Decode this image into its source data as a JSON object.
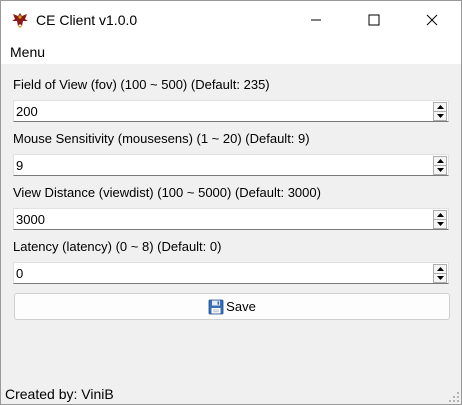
{
  "window": {
    "title": "CE Client v1.0.0",
    "controls": [
      "minimize",
      "maximize",
      "close"
    ]
  },
  "menubar": {
    "items": [
      {
        "label": "Menu"
      }
    ]
  },
  "fields": [
    {
      "label": "Field of View (fov) (100 ~ 500) (Default: 235)",
      "value": "200"
    },
    {
      "label": "Mouse Sensitivity (mousesens) (1 ~ 20) (Default: 9)",
      "value": "9"
    },
    {
      "label": "View Distance (viewdist) (100 ~ 5000) (Default: 3000)",
      "value": "3000"
    },
    {
      "label": "Latency (latency) (0 ~ 8) (Default: 0)",
      "value": "0"
    }
  ],
  "save_button": {
    "label": "Save",
    "icon": "floppy-disk-icon"
  },
  "footer": {
    "text": "Created by: ViniB"
  },
  "colors": {
    "background": "#f0f0f0",
    "titlebar": "#ffffff",
    "field_border": "#7a7a7a"
  }
}
